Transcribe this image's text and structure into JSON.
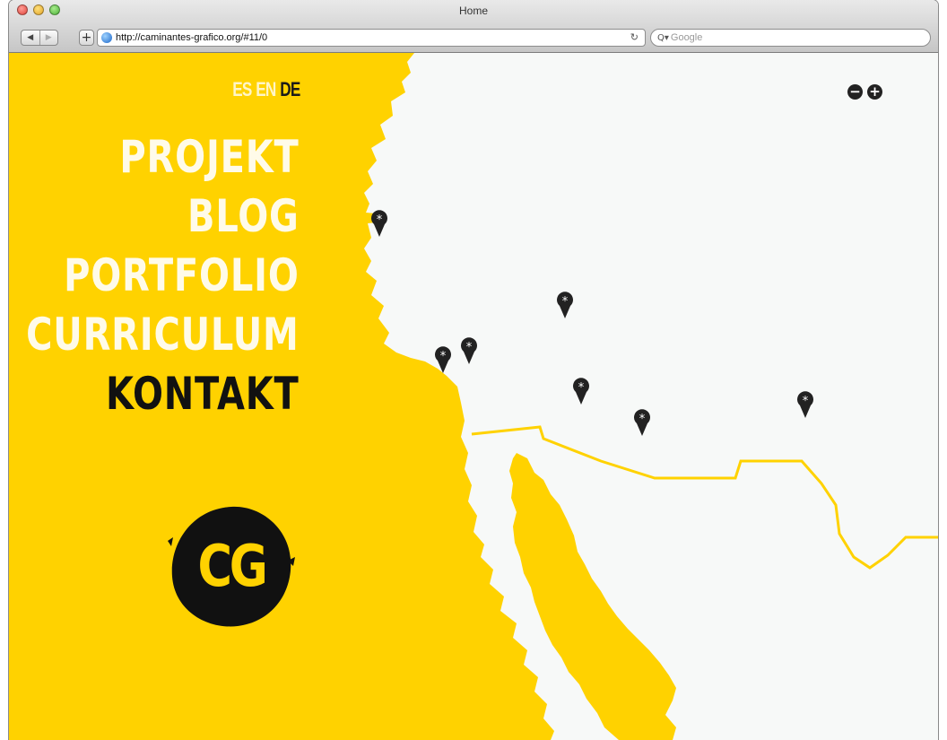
{
  "window": {
    "title": "Home",
    "back_glyph": "◀",
    "forward_glyph": "▶",
    "add_glyph": "+",
    "url": "http://caminantes-grafico.org/#11/0",
    "reload_glyph": "↻",
    "search_icon_glyph": "Q▾",
    "search_placeholder": "Google"
  },
  "languages": [
    {
      "code": "ES",
      "active": false
    },
    {
      "code": "EN",
      "active": false
    },
    {
      "code": "DE",
      "active": true
    }
  ],
  "menu": {
    "items": [
      {
        "label": "PROJEKT",
        "active": false
      },
      {
        "label": "BLOG",
        "active": false
      },
      {
        "label": "PORTFOLIO",
        "active": false
      },
      {
        "label": "CURRICULUM",
        "active": false
      },
      {
        "label": "KONTAKT",
        "active": true
      }
    ]
  },
  "logo": {
    "text": "CG"
  },
  "map": {
    "zoom_out_glyph": "−",
    "zoom_in_glyph": "+",
    "marker_glyph": "*",
    "marker_count": 8
  },
  "colors": {
    "brand_yellow": "#ffd200",
    "land": "#f7f9f8",
    "marker": "#222222",
    "menu_inactive": "#fffbe9",
    "menu_active": "#111111"
  }
}
